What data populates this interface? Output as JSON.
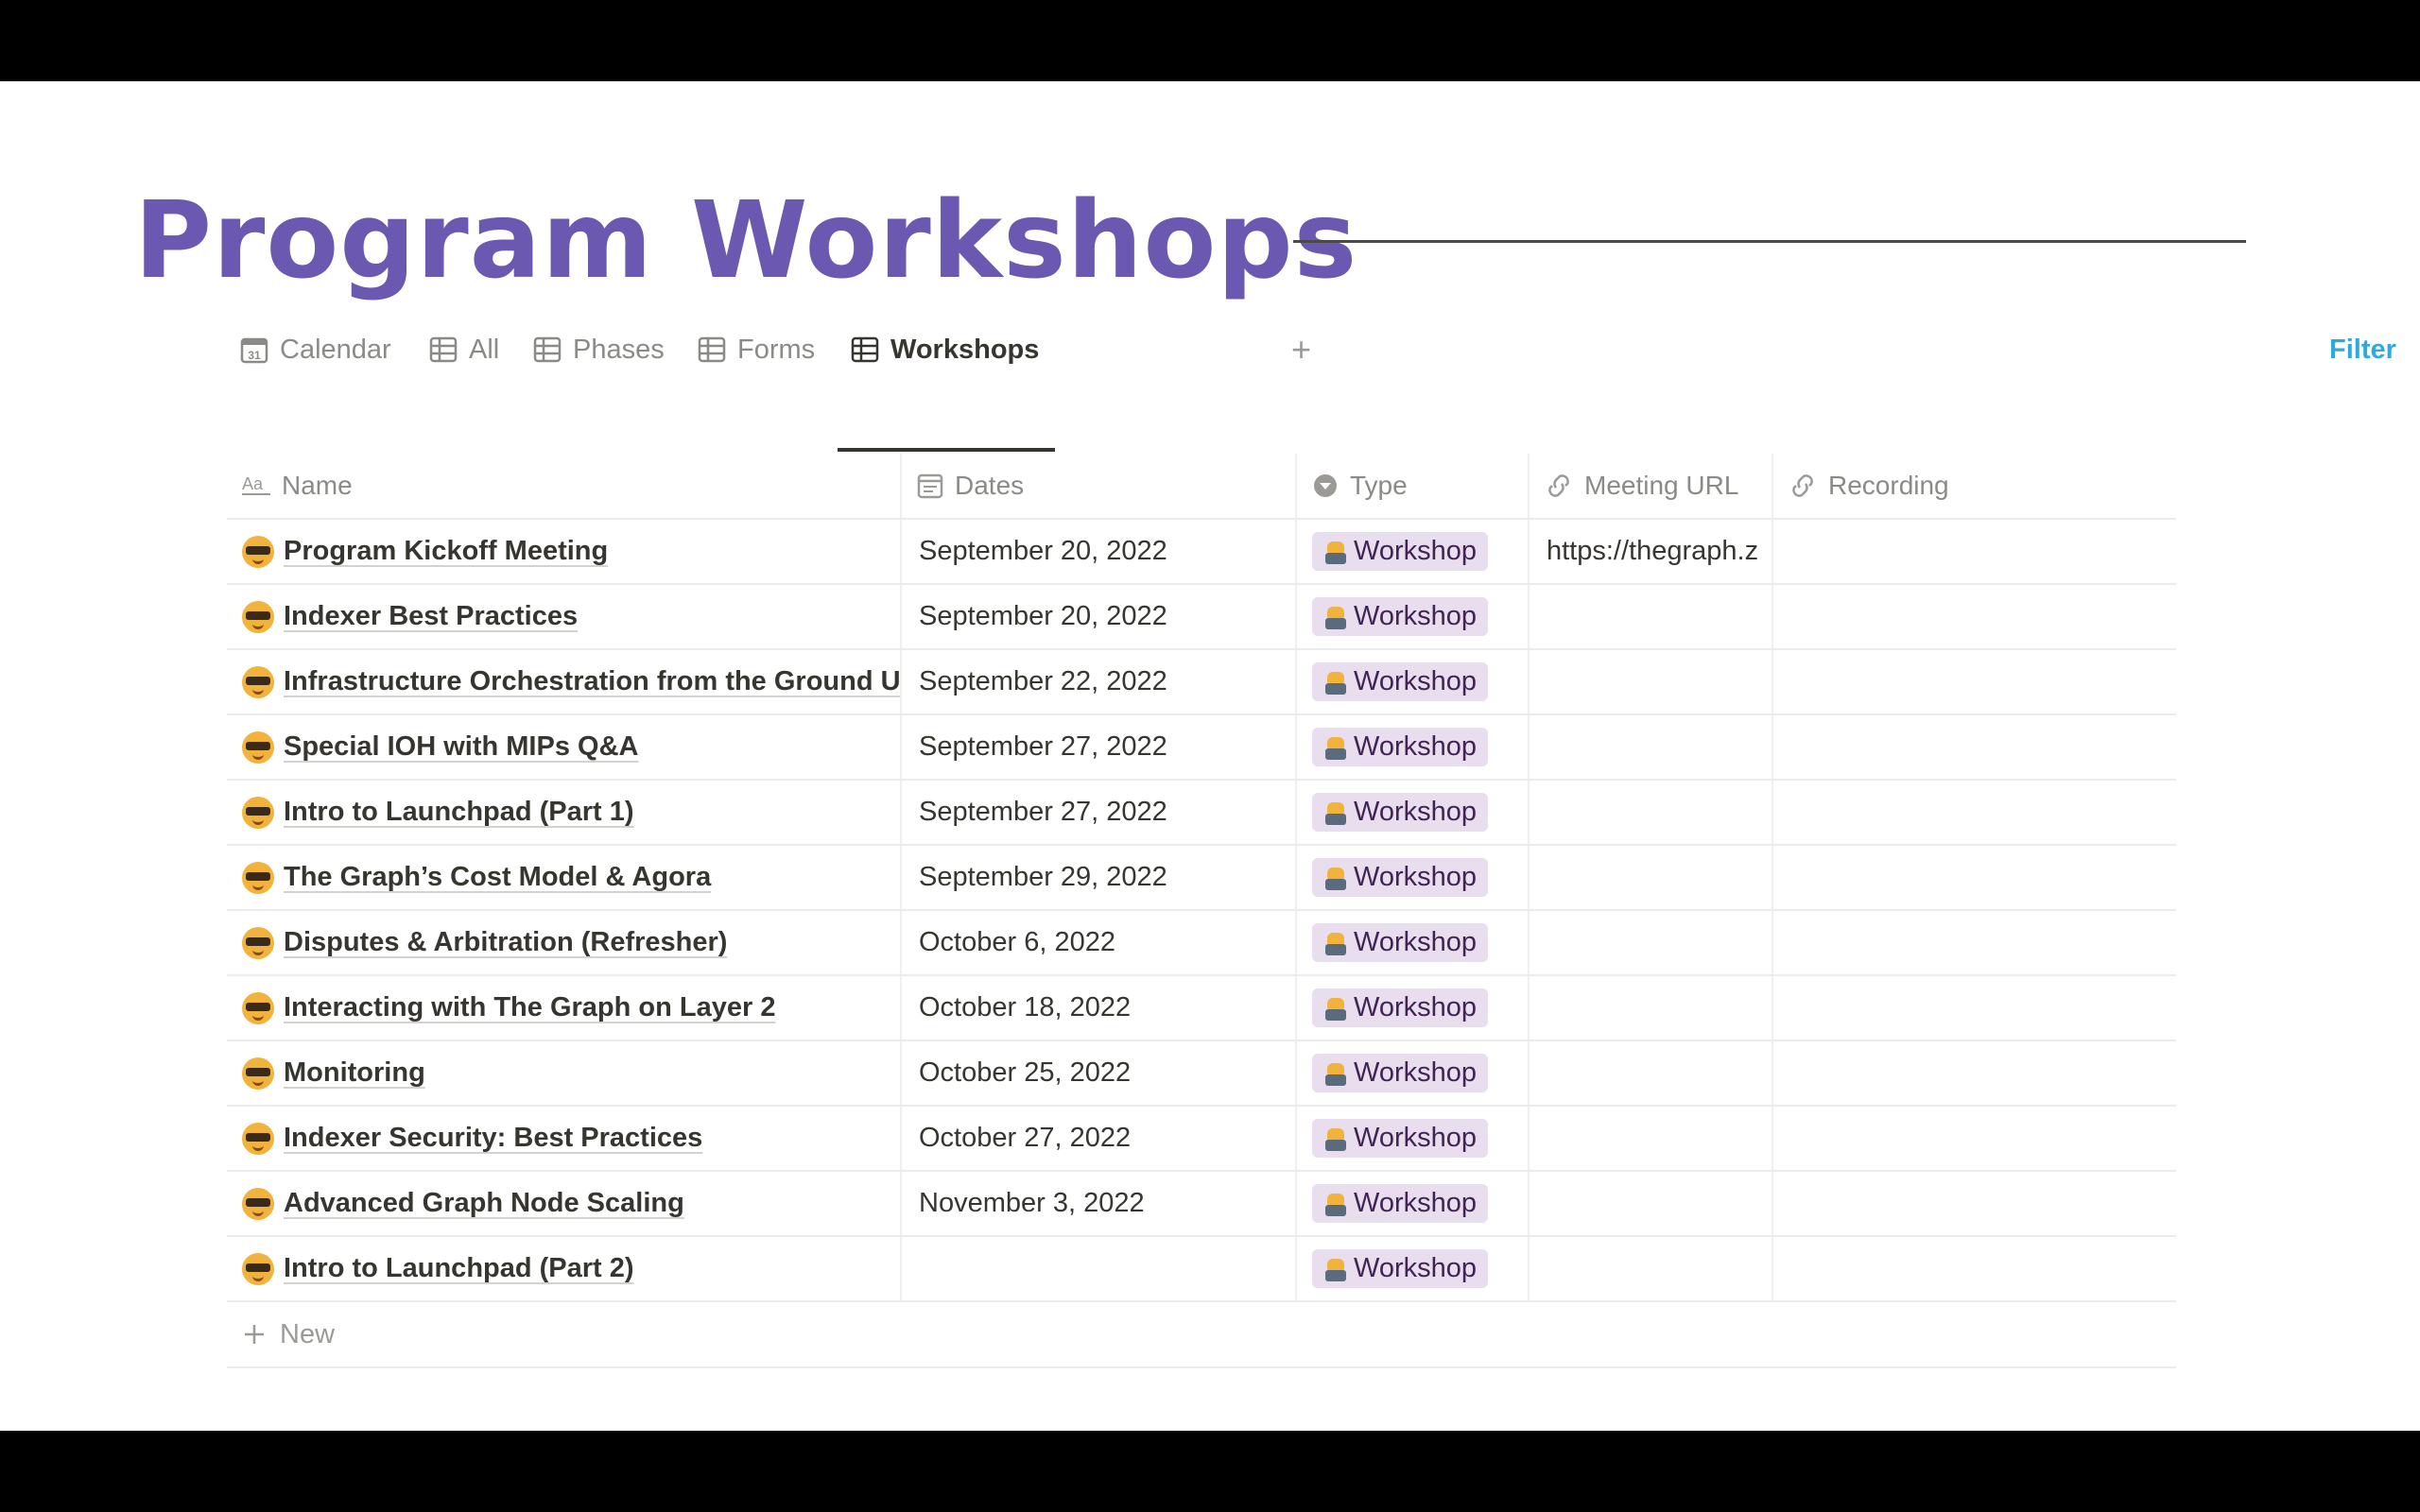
{
  "slide": {
    "title": "Program Workshops"
  },
  "tabs": [
    {
      "label": "Calendar",
      "icon": "calendar-icon"
    },
    {
      "label": "All",
      "icon": "table-icon"
    },
    {
      "label": "Phases",
      "icon": "table-icon"
    },
    {
      "label": "Forms",
      "icon": "table-icon"
    },
    {
      "label": "Workshops",
      "icon": "table-icon",
      "active": true
    }
  ],
  "tab_add": "+",
  "filter_label": "Filter",
  "columns": {
    "name": "Name",
    "dates": "Dates",
    "type": "Type",
    "meeting_url": "Meeting URL",
    "recording": "Recording"
  },
  "rows": [
    {
      "name": "Program Kickoff Meeting",
      "dates": "September 20, 2022",
      "type": "Workshop",
      "meeting_url": "https://thegraph.z",
      "recording": ""
    },
    {
      "name": "Indexer Best Practices",
      "dates": "September 20, 2022",
      "type": "Workshop",
      "meeting_url": "",
      "recording": ""
    },
    {
      "name": "Infrastructure Orchestration from the Ground U",
      "dates": "September 22, 2022",
      "type": "Workshop",
      "meeting_url": "",
      "recording": ""
    },
    {
      "name": "Special IOH with MIPs Q&A",
      "dates": "September 27, 2022",
      "type": "Workshop",
      "meeting_url": "",
      "recording": ""
    },
    {
      "name": "Intro to Launchpad (Part 1)",
      "dates": "September 27, 2022",
      "type": "Workshop",
      "meeting_url": "",
      "recording": ""
    },
    {
      "name": "The Graph’s Cost Model & Agora",
      "dates": "September 29, 2022",
      "type": "Workshop",
      "meeting_url": "",
      "recording": ""
    },
    {
      "name": "Disputes & Arbitration (Refresher)",
      "dates": "October 6, 2022",
      "type": "Workshop",
      "meeting_url": "",
      "recording": ""
    },
    {
      "name": "Interacting with The Graph on Layer 2",
      "dates": "October 18, 2022",
      "type": "Workshop",
      "meeting_url": "",
      "recording": ""
    },
    {
      "name": "Monitoring",
      "dates": "October 25, 2022",
      "type": "Workshop",
      "meeting_url": "",
      "recording": ""
    },
    {
      "name": "Indexer Security: Best Practices",
      "dates": "October 27, 2022",
      "type": "Workshop",
      "meeting_url": "",
      "recording": ""
    },
    {
      "name": "Advanced Graph Node Scaling",
      "dates": "November 3, 2022",
      "type": "Workshop",
      "meeting_url": "",
      "recording": ""
    },
    {
      "name": "Intro to Launchpad (Part 2)",
      "dates": "",
      "type": "Workshop",
      "meeting_url": "",
      "recording": ""
    }
  ],
  "new_row_label": "New",
  "colors": {
    "title": "#6b58b0",
    "filter": "#2eaadc",
    "tag_bg": "#e8deee"
  }
}
